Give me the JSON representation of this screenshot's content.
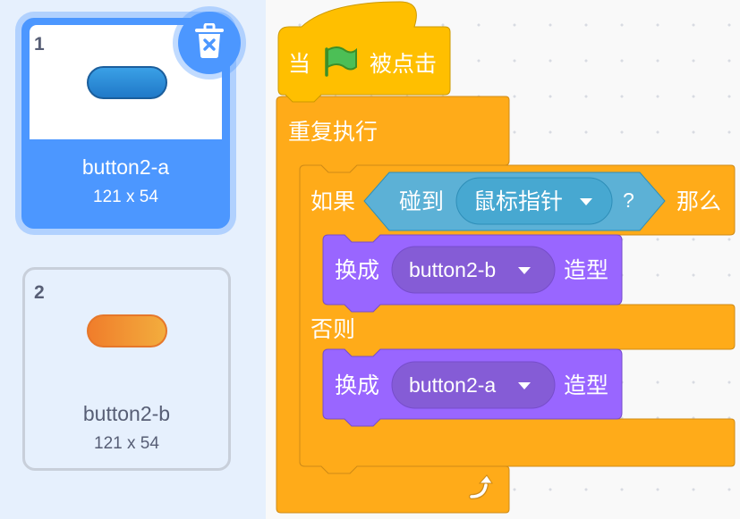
{
  "costumes": [
    {
      "number": "1",
      "name": "button2-a",
      "size": "121 x 54",
      "selected": true,
      "color": "#2a86d6"
    },
    {
      "number": "2",
      "name": "button2-b",
      "size": "121 x 54",
      "selected": false,
      "color": "#f2923a"
    }
  ],
  "blocks": {
    "hat": {
      "prefix": "当",
      "suffix": "被点击",
      "icon": "green-flag-icon"
    },
    "forever": {
      "label": "重复执行",
      "icon": "loop-arrow-icon"
    },
    "if_else": {
      "if_label": "如果",
      "then_label": "那么",
      "else_label": "否则"
    },
    "touching": {
      "label": "碰到",
      "target": "鼠标指针",
      "question": "?"
    },
    "switch_costume_1": {
      "label": "换成",
      "costume": "button2-b",
      "suffix": "造型"
    },
    "switch_costume_2": {
      "label": "换成",
      "costume": "button2-a",
      "suffix": "造型"
    }
  },
  "colors": {
    "events": "#ffbf00",
    "control": "#ffab19",
    "sensing": "#5cb1d6",
    "looks": "#9966ff",
    "selected": "#4c97ff"
  }
}
